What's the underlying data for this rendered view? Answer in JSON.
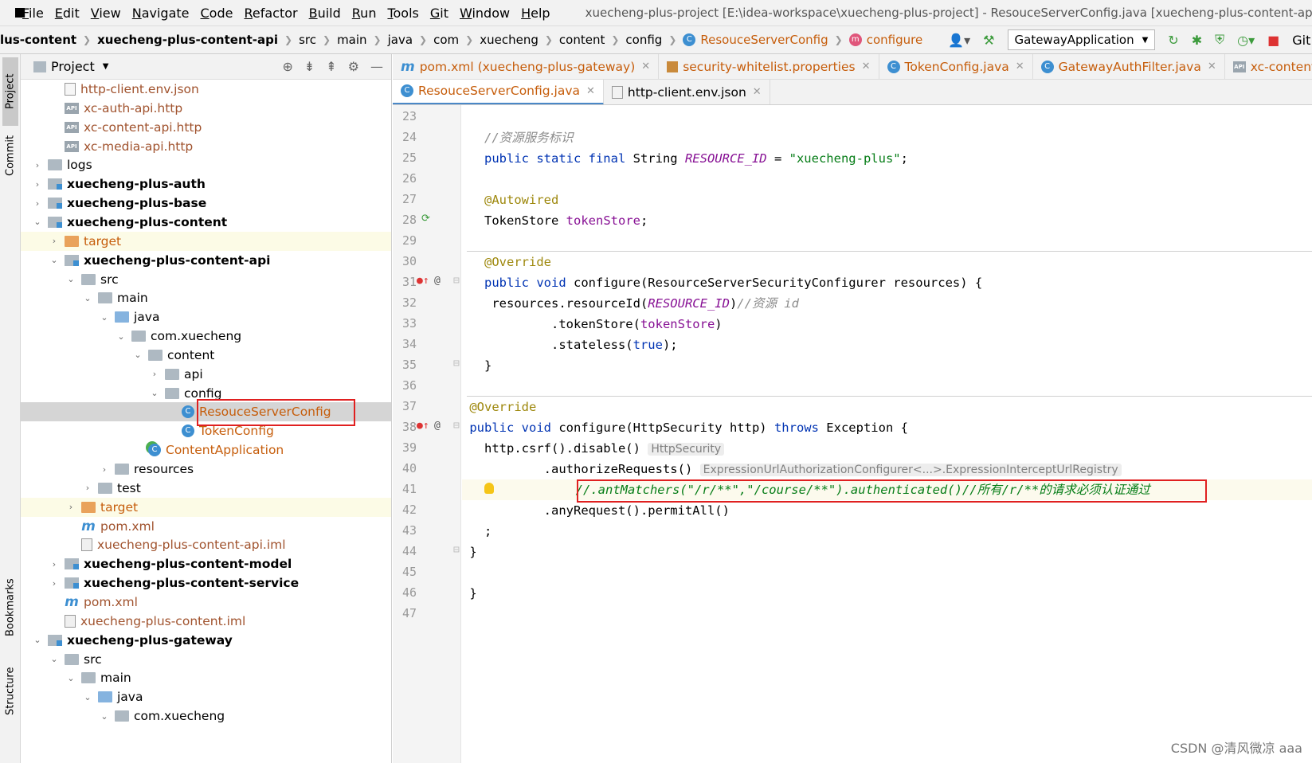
{
  "menubar": {
    "items": [
      "File",
      "Edit",
      "View",
      "Navigate",
      "Code",
      "Refactor",
      "Build",
      "Run",
      "Tools",
      "Git",
      "Window",
      "Help"
    ],
    "title": "xuecheng-plus-project [E:\\idea-workspace\\xuecheng-plus-project] - ResouceServerConfig.java [xuecheng-plus-content-api]"
  },
  "navbar": {
    "crumbs": [
      "lus-content",
      "xuecheng-plus-content-api",
      "src",
      "main",
      "java",
      "com",
      "xuecheng",
      "content",
      "config",
      "ResouceServerConfig",
      "configure"
    ],
    "run_config": "GatewayApplication",
    "git_label": "Git:"
  },
  "leftstrip": {
    "project": "Project",
    "commit": "Commit",
    "bookmarks": "Bookmarks",
    "structure": "Structure"
  },
  "project_panel": {
    "title": "Project",
    "tree": [
      {
        "label": "http-client.env.json",
        "icon": "json",
        "style": "brown"
      },
      {
        "label": "xc-auth-api.http",
        "icon": "api",
        "style": "brown"
      },
      {
        "label": "xc-content-api.http",
        "icon": "api",
        "style": "brown"
      },
      {
        "label": "xc-media-api.http",
        "icon": "api",
        "style": "brown"
      },
      {
        "label": "logs",
        "icon": "folder"
      },
      {
        "label": "xuecheng-plus-auth",
        "icon": "module",
        "style": "bold"
      },
      {
        "label": "xuecheng-plus-base",
        "icon": "module",
        "style": "bold"
      },
      {
        "label": "xuecheng-plus-content",
        "icon": "module",
        "style": "bold"
      },
      {
        "label": "target",
        "icon": "folder-orange",
        "style": "orange"
      },
      {
        "label": "xuecheng-plus-content-api",
        "icon": "module",
        "style": "bold"
      },
      {
        "label": "src",
        "icon": "folder"
      },
      {
        "label": "main",
        "icon": "folder"
      },
      {
        "label": "java",
        "icon": "folder-blue"
      },
      {
        "label": "com.xuecheng",
        "icon": "folder"
      },
      {
        "label": "content",
        "icon": "folder"
      },
      {
        "label": "api",
        "icon": "folder"
      },
      {
        "label": "config",
        "icon": "folder"
      },
      {
        "label": "ResouceServerConfig",
        "icon": "cls",
        "style": "orange"
      },
      {
        "label": "TokenConfig",
        "icon": "cls",
        "style": "orange"
      },
      {
        "label": "ContentApplication",
        "icon": "app",
        "style": "orange"
      },
      {
        "label": "resources",
        "icon": "folder"
      },
      {
        "label": "test",
        "icon": "folder"
      },
      {
        "label": "target",
        "icon": "folder-orange",
        "style": "orange"
      },
      {
        "label": "pom.xml",
        "icon": "m",
        "style": "brown"
      },
      {
        "label": "xuecheng-plus-content-api.iml",
        "icon": "iml",
        "style": "brown"
      },
      {
        "label": "xuecheng-plus-content-model",
        "icon": "module",
        "style": "bold"
      },
      {
        "label": "xuecheng-plus-content-service",
        "icon": "module",
        "style": "bold"
      },
      {
        "label": "pom.xml",
        "icon": "m",
        "style": "brown"
      },
      {
        "label": "xuecheng-plus-content.iml",
        "icon": "iml",
        "style": "brown"
      },
      {
        "label": "xuecheng-plus-gateway",
        "icon": "module",
        "style": "bold"
      },
      {
        "label": "src",
        "icon": "folder"
      },
      {
        "label": "main",
        "icon": "folder"
      },
      {
        "label": "java",
        "icon": "folder-blue"
      },
      {
        "label": "com.xuecheng",
        "icon": "folder"
      }
    ]
  },
  "editor_tabs": {
    "row1": [
      {
        "label": "pom.xml (xuecheng-plus-gateway)",
        "icon": "m",
        "orange": true
      },
      {
        "label": "security-whitelist.properties",
        "icon": "p",
        "orange": true
      },
      {
        "label": "TokenConfig.java",
        "icon": "c",
        "orange": true
      },
      {
        "label": "GatewayAuthFilter.java",
        "icon": "c",
        "orange": true
      },
      {
        "label": "xc-content-ap",
        "icon": "a",
        "orange": true
      }
    ],
    "row2": [
      {
        "label": "ResouceServerConfig.java",
        "icon": "c",
        "orange": true,
        "active": true
      },
      {
        "label": "http-client.env.json",
        "icon": "j",
        "orange": false
      }
    ]
  },
  "code": {
    "line_numbers": [
      "23",
      "24",
      "25",
      "26",
      "27",
      "28",
      "29",
      "30",
      "31",
      "32",
      "33",
      "34",
      "35",
      "36",
      "37",
      "38",
      "39",
      "40",
      "41",
      "42",
      "43",
      "44",
      "45",
      "46",
      "47"
    ],
    "l24_comment": "//资源服务标识",
    "l25_a": "public static final",
    "l25_b": " String ",
    "l25_c": "RESOURCE_ID",
    "l25_d": " = ",
    "l25_e": "\"xuecheng-plus\"",
    "l25_f": ";",
    "l27": "@Autowired",
    "l28_a": "TokenStore ",
    "l28_b": "tokenStore",
    "l28_c": ";",
    "l30": "@Override",
    "l31_a": "public void",
    "l31_b": " configure(ResourceServerSecurityConfigurer resources) {",
    "l32_a": "resources.resourceId(",
    "l32_b": "RESOURCE_ID",
    "l32_c": ")",
    "l32_d": "//资源 id",
    "l33_a": ".tokenStore(",
    "l33_b": "tokenStore",
    "l33_c": ")",
    "l34_a": ".stateless(",
    "l34_b": "true",
    "l34_c": ");",
    "l35": "}",
    "l37": "@Override",
    "l38_a": "public void",
    "l38_b": " configure(HttpSecurity http) ",
    "l38_c": "throws",
    "l38_d": " Exception {",
    "l39_a": "http.csrf().disable()",
    "l39_hint": "HttpSecurity",
    "l40_a": ".authorizeRequests()",
    "l40_hint": "ExpressionUrlAuthorizationConfigurer<...>.ExpressionInterceptUrlRegistry",
    "l41": "//.antMatchers(\"/r/**\",\"/course/**\").authenticated()//所有/r/**的请求必须认证通过",
    "l42": ".anyRequest().permitAll()",
    "l43": ";",
    "l44": "}",
    "l46": "}"
  },
  "watermark": "CSDN @清风微凉 aaa"
}
